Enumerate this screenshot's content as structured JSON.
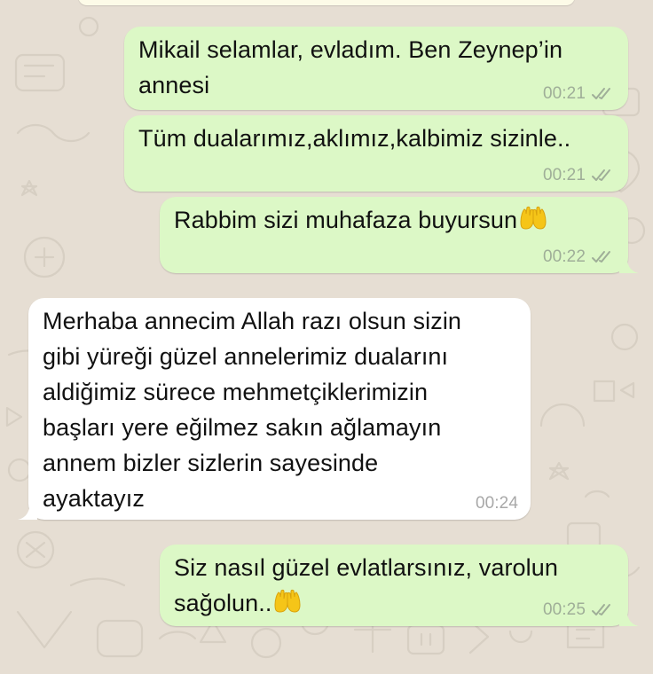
{
  "chat": {
    "messages": [
      {
        "direction": "outgoing",
        "text": "Mikail selamlar, evladım. Ben Zeynep’in\nannesi",
        "time": "00:21",
        "status_icon": "double-check-icon"
      },
      {
        "direction": "outgoing",
        "text": "Tüm dualarımız,aklımız,kalbimiz sizinle..",
        "time": "00:21",
        "status_icon": "double-check-icon"
      },
      {
        "direction": "outgoing",
        "text": "Rabbim sizi muhafaza buyursun",
        "emoji": "open-hands-emoji",
        "time": "00:22",
        "status_icon": "double-check-icon"
      },
      {
        "direction": "incoming",
        "text": "Merhaba annecim Allah razı olsun sizin\ngibi yüreği güzel annelerimiz dualarını\naldiğimiz sürece mehmetçiklerimizin\nbaşları yere eğilmez sakın ağlamayın\nannem bizler sizlerin sayesinde\nayaktayız",
        "time": "00:24"
      },
      {
        "direction": "outgoing",
        "text": "Siz nasıl güzel evlatlarsınız, varolun\nsağolun..",
        "emoji": "open-hands-emoji",
        "time": "00:25",
        "status_icon": "double-check-icon"
      }
    ]
  },
  "colors": {
    "background": "#e6ded3",
    "outgoing_bubble": "#dcf8c6",
    "incoming_bubble": "#ffffff",
    "timestamp_outgoing": "#9fae98",
    "timestamp_incoming": "#a8a8a8",
    "emoji": "#f5c518"
  }
}
